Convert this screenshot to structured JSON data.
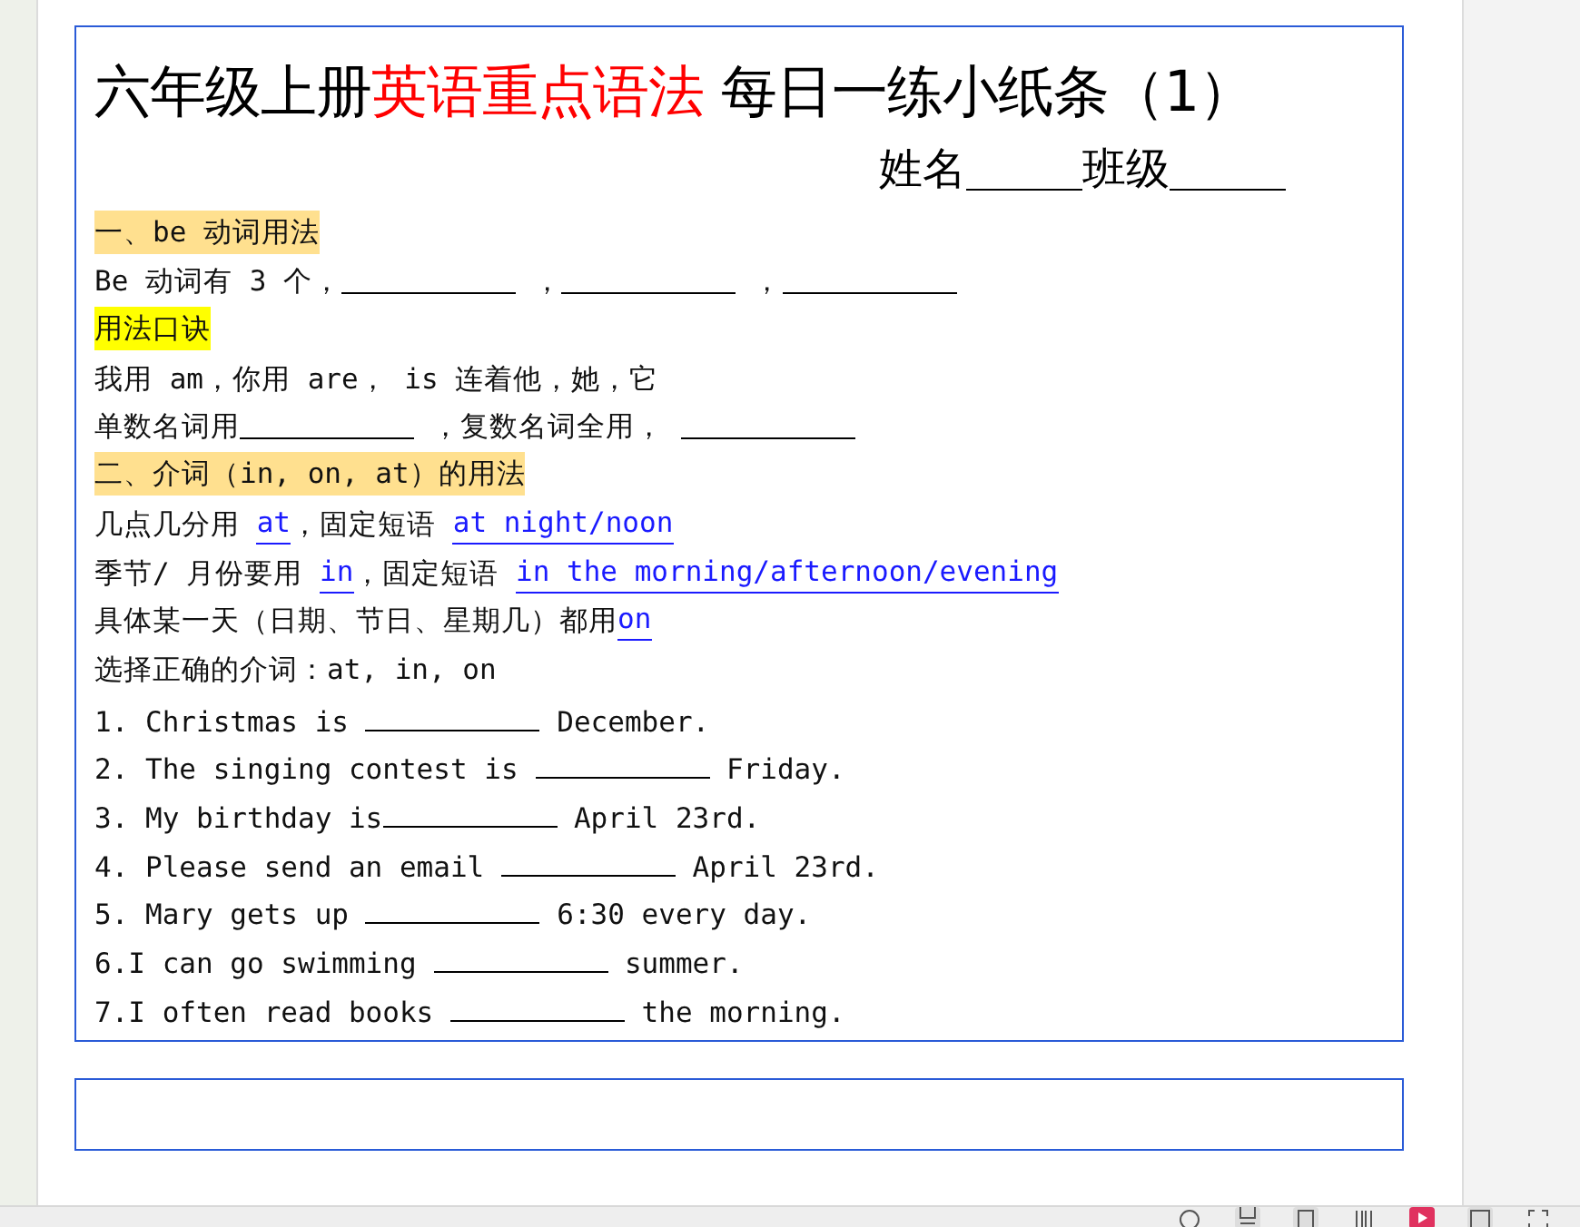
{
  "title": [
    {
      "text": "六年级上册",
      "emphasis": false
    },
    {
      "text": "英语重点语法",
      "emphasis": true
    },
    {
      "text": " 每日一练小纸条（1）",
      "emphasis": false
    }
  ],
  "name_fields": [
    {
      "label": "姓名"
    },
    {
      "label": "班级"
    }
  ],
  "lines": [
    {
      "kind": "heading",
      "color": "#ffe08f",
      "segments": [
        {
          "kind": "text",
          "text": "一、be 动词用法"
        }
      ]
    },
    {
      "kind": "text",
      "segments": [
        {
          "kind": "text",
          "text": "Be 动词有 3 个，"
        },
        {
          "kind": "blank"
        },
        {
          "kind": "text",
          "text": " ，"
        },
        {
          "kind": "blank"
        },
        {
          "kind": "text",
          "text": " ，"
        },
        {
          "kind": "blank"
        }
      ]
    },
    {
      "kind": "heading",
      "color": "#ffff00",
      "segments": [
        {
          "kind": "text",
          "text": "用法口诀"
        }
      ]
    },
    {
      "kind": "text",
      "segments": [
        {
          "kind": "text",
          "text": "我用 am，你用 are， is 连着他，她，它"
        }
      ]
    },
    {
      "kind": "text",
      "segments": [
        {
          "kind": "text",
          "text": "单数名词用"
        },
        {
          "kind": "blank"
        },
        {
          "kind": "text",
          "text": " ，复数名词全用， "
        },
        {
          "kind": "blank"
        }
      ]
    },
    {
      "kind": "heading",
      "color": "#ffe08f",
      "segments": [
        {
          "kind": "text",
          "text": "二、介词（in, on, at）的用法"
        }
      ]
    },
    {
      "kind": "text",
      "segments": [
        {
          "kind": "text",
          "text": "几点几分用 "
        },
        {
          "kind": "answer",
          "text": "at"
        },
        {
          "kind": "text",
          "text": "，固定短语 "
        },
        {
          "kind": "answer",
          "text": "at night/noon"
        }
      ]
    },
    {
      "kind": "text",
      "segments": [
        {
          "kind": "text",
          "text": "季节/ 月份要用 "
        },
        {
          "kind": "answer",
          "text": "in"
        },
        {
          "kind": "text",
          "text": "，固定短语 "
        },
        {
          "kind": "answer",
          "text": "in the morning/afternoon/evening"
        }
      ]
    },
    {
      "kind": "text",
      "segments": [
        {
          "kind": "text",
          "text": "具体某一天（日期、节日、星期几）都用"
        },
        {
          "kind": "answer",
          "text": "on"
        }
      ]
    },
    {
      "kind": "text",
      "segments": [
        {
          "kind": "text",
          "text": "选择正确的介词：at, in, on"
        }
      ]
    },
    {
      "kind": "text",
      "segments": [
        {
          "kind": "text",
          "text": "1. Christmas is "
        },
        {
          "kind": "blank"
        },
        {
          "kind": "text",
          "text": " December."
        }
      ]
    },
    {
      "kind": "text",
      "segments": [
        {
          "kind": "text",
          "text": "2. The singing contest is "
        },
        {
          "kind": "blank"
        },
        {
          "kind": "text",
          "text": " Friday."
        }
      ]
    },
    {
      "kind": "text",
      "segments": [
        {
          "kind": "text",
          "text": "3. My birthday is"
        },
        {
          "kind": "blank"
        },
        {
          "kind": "text",
          "text": " April 23rd."
        }
      ]
    },
    {
      "kind": "text",
      "segments": [
        {
          "kind": "text",
          "text": "4. Please send an email "
        },
        {
          "kind": "blank"
        },
        {
          "kind": "text",
          "text": " April 23rd."
        }
      ]
    },
    {
      "kind": "text",
      "segments": [
        {
          "kind": "text",
          "text": "5. Mary gets up "
        },
        {
          "kind": "blank"
        },
        {
          "kind": "text",
          "text": " 6:30 every day."
        }
      ]
    },
    {
      "kind": "text",
      "segments": [
        {
          "kind": "text",
          "text": "6.I can go swimming "
        },
        {
          "kind": "blank"
        },
        {
          "kind": "text",
          "text": " summer."
        }
      ]
    },
    {
      "kind": "text",
      "segments": [
        {
          "kind": "text",
          "text": "7.I often read books "
        },
        {
          "kind": "blank"
        },
        {
          "kind": "text",
          "text": " the morning."
        }
      ]
    }
  ]
}
